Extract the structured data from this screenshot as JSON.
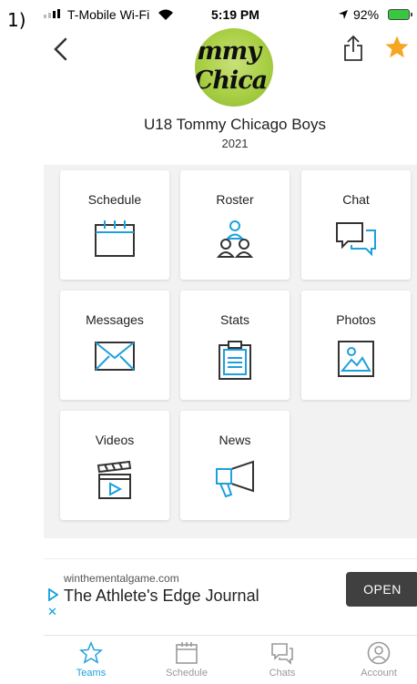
{
  "prefix": "1)",
  "status_bar": {
    "carrier": "T-Mobile Wi-Fi",
    "time": "5:19 PM",
    "battery": "92%"
  },
  "team": {
    "logo_line1": "mmy",
    "logo_line2": "Chica",
    "name": "U18 Tommy Chicago Boys",
    "year": "2021"
  },
  "tiles": [
    {
      "label": "Schedule",
      "icon": "calendar-icon"
    },
    {
      "label": "Roster",
      "icon": "people-icon"
    },
    {
      "label": "Chat",
      "icon": "chat-bubbles-icon"
    },
    {
      "label": "Messages",
      "icon": "envelope-icon"
    },
    {
      "label": "Stats",
      "icon": "clipboard-icon"
    },
    {
      "label": "Photos",
      "icon": "image-icon"
    },
    {
      "label": "Videos",
      "icon": "clapperboard-icon"
    },
    {
      "label": "News",
      "icon": "megaphone-icon"
    }
  ],
  "ad": {
    "domain": "winthementalgame.com",
    "title": "The Athlete's Edge Journal",
    "button": "OPEN"
  },
  "tabbar": [
    {
      "label": "Teams",
      "icon": "star-outline-icon",
      "active": true
    },
    {
      "label": "Schedule",
      "icon": "calendar-icon",
      "active": false
    },
    {
      "label": "Chats",
      "icon": "chat-icon",
      "active": false
    },
    {
      "label": "Account",
      "icon": "account-icon",
      "active": false
    }
  ],
  "colors": {
    "accent": "#1ea0dc",
    "star": "#f5a623",
    "icon_dark": "#333333",
    "background": "#f2f2f2"
  }
}
